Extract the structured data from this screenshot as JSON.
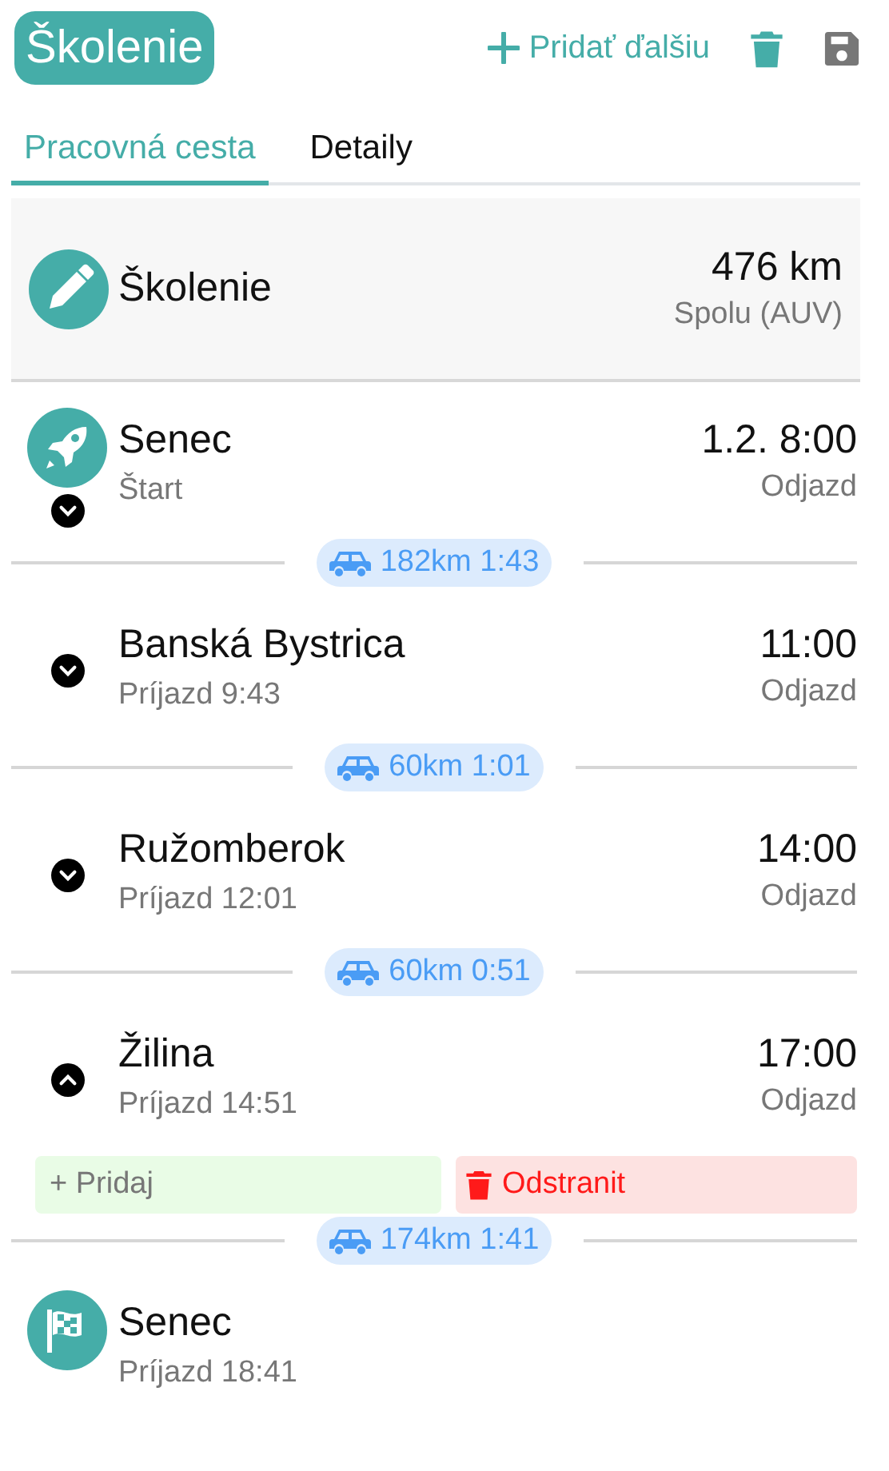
{
  "header": {
    "title": "Školenie",
    "add_label": "Pridať ďalšiu"
  },
  "tabs": [
    {
      "label": "Pracovná cesta",
      "selected": true
    },
    {
      "label": "Detaily",
      "selected": false
    }
  ],
  "summary": {
    "name": "Školenie",
    "distance": "476 km",
    "distance_note": "Spolu (AUV)"
  },
  "stops": [
    {
      "kind": "start",
      "name": "Senec",
      "note": "Štart",
      "time": "1.2. 8:00",
      "time_note": "Odjazd",
      "expanded": false,
      "leg": "182km 1:43"
    },
    {
      "kind": "stop",
      "name": "Banská Bystrica",
      "note": "Príjazd 9:43",
      "time": "11:00",
      "time_note": "Odjazd",
      "expanded": false,
      "leg": "60km 1:01"
    },
    {
      "kind": "stop",
      "name": "Ružomberok",
      "note": "Príjazd 12:01",
      "time": "14:00",
      "time_note": "Odjazd",
      "expanded": false,
      "leg": "60km 0:51"
    },
    {
      "kind": "stop",
      "name": "Žilina",
      "note": "Príjazd 14:51",
      "time": "17:00",
      "time_note": "Odjazd",
      "expanded": true,
      "add_label": "+ Pridaj",
      "remove_label": "Odstranit",
      "leg": "174km 1:41"
    },
    {
      "kind": "end",
      "name": "Senec",
      "note": "Príjazd 18:41"
    }
  ]
}
